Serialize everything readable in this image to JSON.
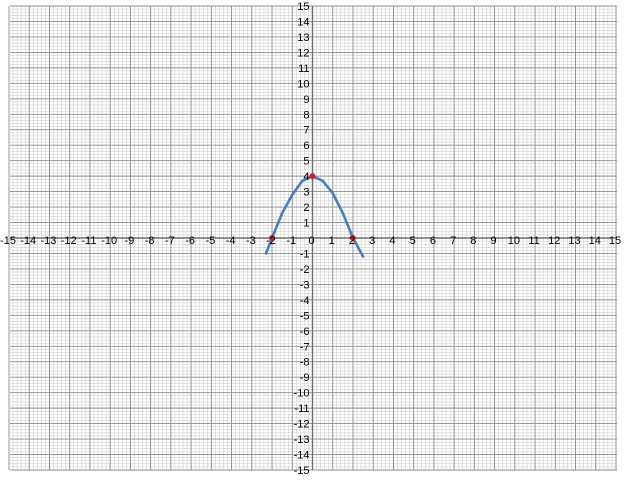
{
  "chart_data": {
    "type": "line",
    "title": "",
    "xlabel": "",
    "ylabel": "",
    "xlim": [
      -15,
      15
    ],
    "ylim": [
      -15,
      15
    ],
    "x_ticks": [
      "-15",
      "-14",
      "-13",
      "-12",
      "-11",
      "-10",
      "-9",
      "-8",
      "-7",
      "-6",
      "-5",
      "-4",
      "-3",
      "-2",
      "-1",
      "0",
      "1",
      "2",
      "3",
      "4",
      "5",
      "6",
      "7",
      "8",
      "9",
      "10",
      "11",
      "12",
      "13",
      "14",
      "15"
    ],
    "y_ticks": [
      "15",
      "14",
      "13",
      "12",
      "11",
      "10",
      "9",
      "8",
      "7",
      "6",
      "5",
      "4",
      "3",
      "2",
      "1",
      "-1",
      "-2",
      "-3",
      "-4",
      "-5",
      "-6",
      "-7",
      "-8",
      "-9",
      "-10",
      "-11",
      "-12",
      "-13",
      "-14",
      "-15"
    ],
    "grid": true,
    "minor_divisions": 5,
    "series": [
      {
        "color": "#4a7ebb",
        "x": [
          -2.3,
          -2.0,
          -1.5,
          -1.0,
          -0.5,
          0.0,
          0.5,
          1.0,
          1.5,
          2.0,
          2.5
        ],
        "y": [
          -1.0,
          0.0,
          1.6,
          2.8,
          3.7,
          4.0,
          3.7,
          2.9,
          1.6,
          0.0,
          -1.2
        ]
      }
    ],
    "points": {
      "color": "#c0262c",
      "x": [
        -2,
        0,
        2
      ],
      "y": [
        0,
        4,
        0
      ]
    },
    "colors": {
      "minor_grid": "#c8c8c8",
      "major_grid": "#8c8c8c",
      "axis": "#6e6e6e"
    }
  }
}
